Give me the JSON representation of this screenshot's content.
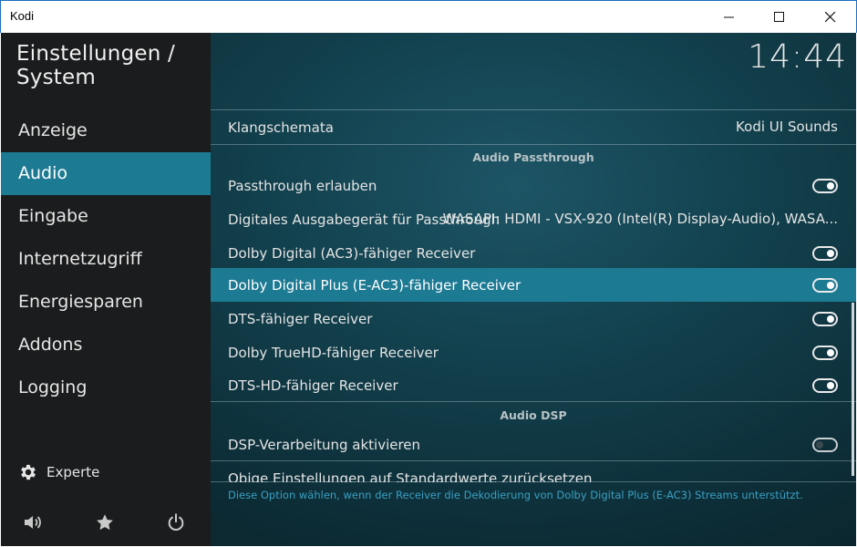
{
  "window": {
    "title": "Kodi"
  },
  "header": {
    "title": "Einstellungen / System",
    "time": "14:44"
  },
  "sidebar": {
    "items": [
      {
        "label": "Anzeige",
        "active": false
      },
      {
        "label": "Audio",
        "active": true
      },
      {
        "label": "Eingabe",
        "active": false
      },
      {
        "label": "Internetzugriff",
        "active": false
      },
      {
        "label": "Energiesparen",
        "active": false
      },
      {
        "label": "Addons",
        "active": false
      },
      {
        "label": "Logging",
        "active": false
      }
    ],
    "level_label": "Experte",
    "bottom_icons": [
      "volume-icon",
      "star-icon",
      "power-icon"
    ]
  },
  "settings": {
    "klangschemata": {
      "label": "Klangschemata",
      "value": "Kodi UI Sounds"
    },
    "section_passthrough": "Audio Passthrough",
    "passthrough_allow": {
      "label": "Passthrough erlauben",
      "on": true
    },
    "passthrough_device": {
      "label": "Digitales Ausgabegerät für Passthrough",
      "value": "WASAPI: HDMI - VSX-920 (Intel(R) Display-Audio), WASA..."
    },
    "ac3": {
      "label": "Dolby Digital (AC3)-fähiger Receiver",
      "on": true
    },
    "eac3": {
      "label": "Dolby Digital Plus (E-AC3)-fähiger Receiver",
      "on": true
    },
    "dts": {
      "label": "DTS-fähiger Receiver",
      "on": true
    },
    "truehd": {
      "label": "Dolby TrueHD-fähiger Receiver",
      "on": true
    },
    "dtshd": {
      "label": "DTS-HD-fähiger Receiver",
      "on": true
    },
    "section_dsp": "Audio DSP",
    "dsp": {
      "label": "DSP-Verarbeitung aktivieren",
      "on": false
    },
    "reset": {
      "label": "Obige Einstellungen auf Standardwerte zurücksetzen"
    }
  },
  "help_text": "Diese Option wählen, wenn der Receiver die Dekodierung von Dolby Digital Plus (E-AC3) Streams unterstützt.",
  "colors": {
    "accent": "#1d7a93",
    "sidebar": "#1b1c1d",
    "help": "#3aa0c2"
  }
}
